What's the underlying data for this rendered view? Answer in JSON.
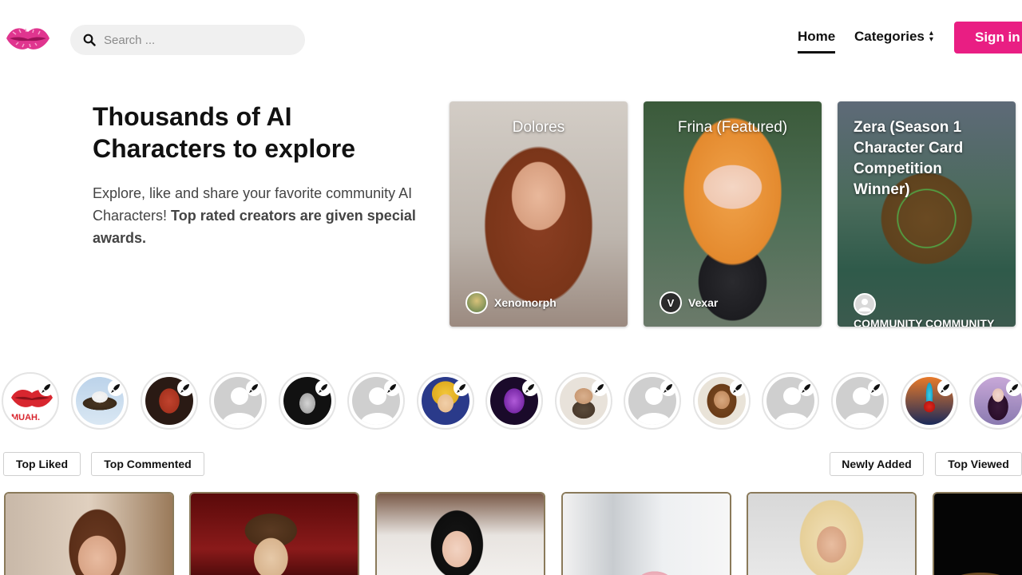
{
  "header": {
    "logo_icon": "lips-icon",
    "search": {
      "placeholder": "Search ..."
    },
    "nav": {
      "home": "Home",
      "categories": "Categories"
    },
    "signin_label": "Sign in"
  },
  "hero": {
    "title": "Thousands of AI Characters to explore",
    "desc_plain": "Explore, like and share your favorite community AI Characters! ",
    "desc_bold": "Top rated creators are given special awards."
  },
  "featured": [
    {
      "title": "Dolores",
      "creator": "Xenomorph",
      "creator_initial": ""
    },
    {
      "title": "Frina (Featured)",
      "creator": "Vexar",
      "creator_initial": "V"
    },
    {
      "title": "Zera (Season 1 Character Card Competition Winner)",
      "creator": "COMMUNITY COMMUNITY",
      "creator_initial": ""
    }
  ],
  "creators": [
    {
      "avatar": "muah-logo"
    },
    {
      "avatar": "eagle"
    },
    {
      "avatar": "devil"
    },
    {
      "avatar": "default-user"
    },
    {
      "avatar": "frankenstein"
    },
    {
      "avatar": "default-user"
    },
    {
      "avatar": "anime-hero"
    },
    {
      "avatar": "purple-alien"
    },
    {
      "avatar": "bearded-man"
    },
    {
      "avatar": "default-user"
    },
    {
      "avatar": "long-hair-man"
    },
    {
      "avatar": "default-user"
    },
    {
      "avatar": "default-user"
    },
    {
      "avatar": "neon-heart"
    },
    {
      "avatar": "anime-girl"
    }
  ],
  "filters": {
    "top_liked": "Top Liked",
    "top_commented": "Top Commented",
    "newly_added": "Newly Added",
    "top_viewed": "Top Viewed"
  },
  "colors": {
    "accent": "#e91e83",
    "card_border": "#8a7a5a"
  }
}
